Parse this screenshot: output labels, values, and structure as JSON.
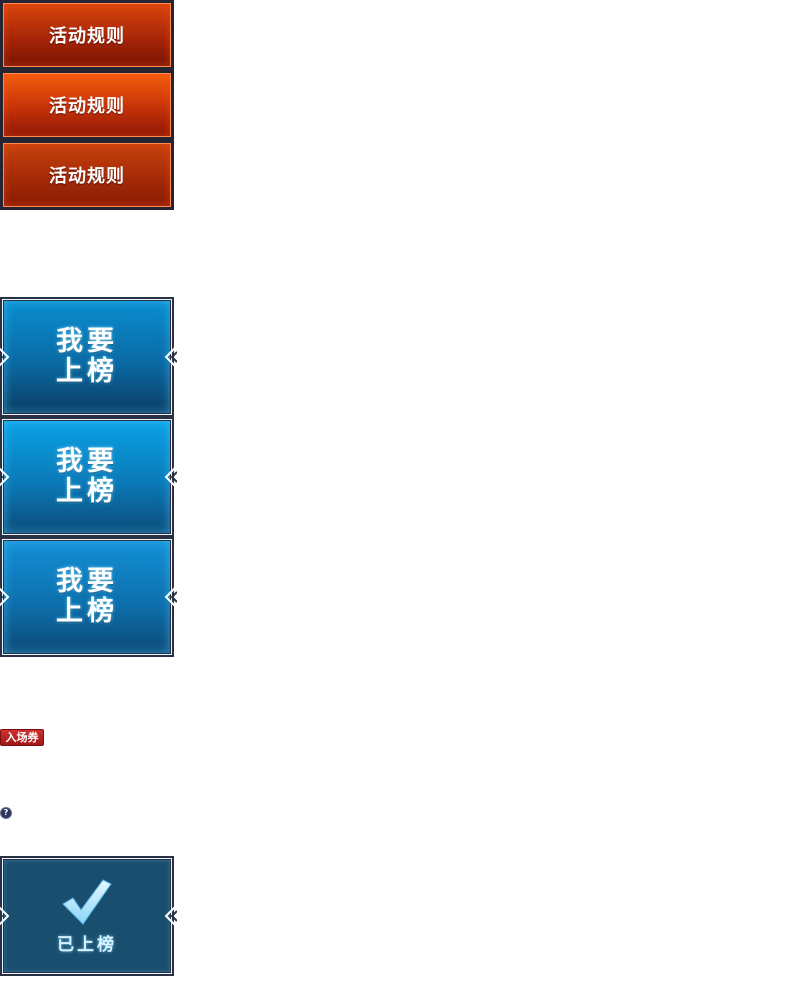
{
  "rules_buttons": [
    {
      "state": "normal",
      "label": "活动规则"
    },
    {
      "state": "hover",
      "label": "活动规则"
    },
    {
      "state": "active",
      "label": "活动规则"
    }
  ],
  "rank_buttons": [
    {
      "state": "normal",
      "line1": "我要",
      "line2": "上榜"
    },
    {
      "state": "hover",
      "line1": "我要",
      "line2": "上榜"
    },
    {
      "state": "active",
      "line1": "我要",
      "line2": "上榜"
    }
  ],
  "ticket_badge": {
    "label": "入场券"
  },
  "help": {
    "glyph": "?"
  },
  "ranked_button": {
    "state": "done",
    "label": "已上榜",
    "icon": "checkmark-icon"
  },
  "colors": {
    "frame_dark": "#242432",
    "rules_red": "#b02a08",
    "rank_blue": "#0a6aa4",
    "ranked_teal": "#1a4e6e",
    "ticket_red": "#c02424"
  }
}
